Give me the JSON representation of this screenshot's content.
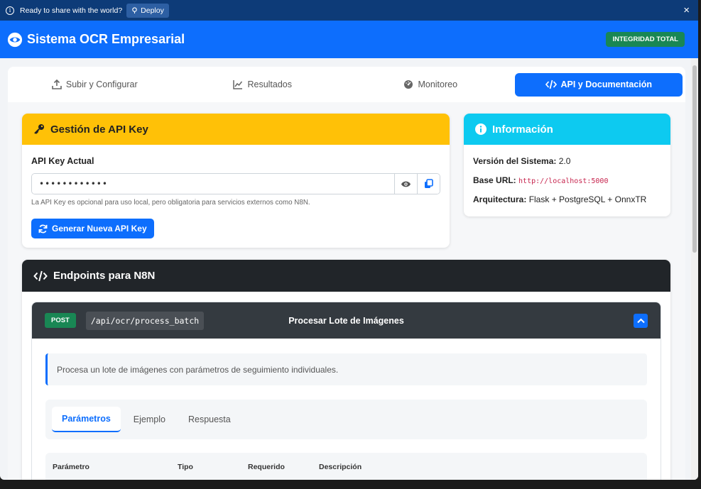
{
  "notice": {
    "text": "Ready to share with the world?",
    "deploy_label": "Deploy",
    "close_label": "×"
  },
  "navbar": {
    "title": "Sistema OCR Empresarial",
    "badge": "INTEGRIDAD TOTAL"
  },
  "tabs": [
    {
      "label": "Subir y Configurar",
      "icon": "upload-icon",
      "active": false
    },
    {
      "label": "Resultados",
      "icon": "chart-line-icon",
      "active": false
    },
    {
      "label": "Monitoreo",
      "icon": "gauge-icon",
      "active": false
    },
    {
      "label": "API y Documentación",
      "icon": "code-icon",
      "active": true
    }
  ],
  "api_key": {
    "title": "Gestión de API Key",
    "field_label": "API Key Actual",
    "value": "••••••••••••",
    "hint": "La API Key es opcional para uso local, pero obligatoria para servicios externos como N8N.",
    "generate_label": "Generar Nueva API Key"
  },
  "info": {
    "title": "Información",
    "version_label": "Versión del Sistema:",
    "version_value": "2.0",
    "base_url_label": "Base URL:",
    "base_url_value": "http://localhost:5000",
    "arch_label": "Arquitectura:",
    "arch_value": "Flask + PostgreSQL + OnnxTR"
  },
  "endpoints": {
    "title": "Endpoints para N8N",
    "item": {
      "method": "POST",
      "path": "/api/ocr/process_batch",
      "title": "Procesar Lote de Imágenes",
      "description": "Procesa un lote de imágenes con parámetros de seguimiento individuales.",
      "subtabs": [
        "Parámetros",
        "Ejemplo",
        "Respuesta"
      ],
      "active_subtab": 0,
      "table_headers": [
        "Parámetro",
        "Tipo",
        "Requerido",
        "Descripción"
      ]
    }
  },
  "colors": {
    "primary": "#0d6efd",
    "warning": "#ffc107",
    "info": "#0dcaf0",
    "dark": "#212529",
    "success": "#198754"
  }
}
